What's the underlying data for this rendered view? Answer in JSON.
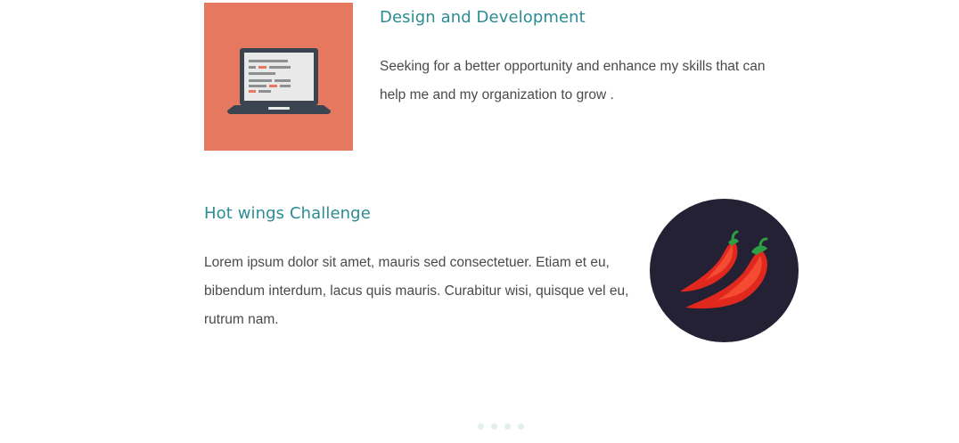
{
  "items": [
    {
      "title": "Design and Development",
      "text": "Seeking for a better opportunity and enhance my skills that can help me and my organization to grow .",
      "icon": "laptop-icon",
      "background": "#e5785f"
    },
    {
      "title": "Hot wings Challenge",
      "text": "Lorem ipsum dolor sit amet, mauris sed consectetuer. Etiam et eu, bibendum interdum, lacus quis mauris. Curabitur wisi, quisque vel eu, rutrum nam.",
      "icon": "chili-peppers-icon",
      "background": "#232133"
    }
  ],
  "pager": {
    "dots": 4
  },
  "colors": {
    "title": "#2b8c93",
    "body_text": "#4a4a4a",
    "pager_dot": "#e3eeee"
  }
}
